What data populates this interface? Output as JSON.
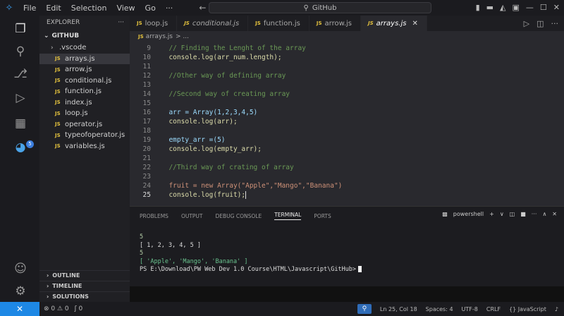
{
  "menu": {
    "items": [
      "File",
      "Edit",
      "Selection",
      "View",
      "Go",
      "···"
    ]
  },
  "nav": {
    "back": "←",
    "forward": "→"
  },
  "search": {
    "text": "GitHub"
  },
  "window": {
    "controls": [
      "▮",
      "▬",
      "◭",
      "▣",
      "—",
      "☐",
      "✕"
    ]
  },
  "activity": {
    "badge": "5"
  },
  "explorer": {
    "title": "EXPLORER",
    "more": "···",
    "folder": "GITHUB",
    "items": [
      {
        "label": ".vscode",
        "kind": "folder"
      },
      {
        "label": "arrays.js",
        "kind": "js",
        "active": true
      },
      {
        "label": "arrow.js",
        "kind": "js"
      },
      {
        "label": "conditional.js",
        "kind": "js"
      },
      {
        "label": "function.js",
        "kind": "js"
      },
      {
        "label": "index.js",
        "kind": "js"
      },
      {
        "label": "loop.js",
        "kind": "js"
      },
      {
        "label": "operator.js",
        "kind": "js"
      },
      {
        "label": "typeofoperator.js",
        "kind": "js"
      },
      {
        "label": "variables.js",
        "kind": "js"
      }
    ],
    "sections": [
      "OUTLINE",
      "TIMELINE",
      "SOLUTIONS"
    ]
  },
  "tabs": [
    {
      "label": "loop.js"
    },
    {
      "label": "conditional.js",
      "italic": true
    },
    {
      "label": "function.js"
    },
    {
      "label": "arrow.js"
    },
    {
      "label": "arrays.js",
      "active": true
    }
  ],
  "tab_close": "✕",
  "breadcrumb": {
    "file": "arrays.js",
    "sep": "> ..."
  },
  "editor": {
    "lines": [
      {
        "n": "9",
        "code": "  // Finding the Lenght of the array"
      },
      {
        "n": "10",
        "code": "  console.log(arr_num.length);"
      },
      {
        "n": "11",
        "code": ""
      },
      {
        "n": "12",
        "code": "  //Other way of defining array"
      },
      {
        "n": "13",
        "code": ""
      },
      {
        "n": "14",
        "code": "  //Second way of creating array"
      },
      {
        "n": "15",
        "code": ""
      },
      {
        "n": "16",
        "code": "  arr = Array(1,2,3,4,5)"
      },
      {
        "n": "17",
        "code": "  console.log(arr);"
      },
      {
        "n": "18",
        "code": ""
      },
      {
        "n": "19",
        "code": "  empty_arr =(5)"
      },
      {
        "n": "20",
        "code": "  console.log(empty_arr);"
      },
      {
        "n": "21",
        "code": ""
      },
      {
        "n": "22",
        "code": "  //Third way of crating of array"
      },
      {
        "n": "23",
        "code": ""
      },
      {
        "n": "24",
        "code": "  fruit = new Array(\"Apple\",\"Mango\",\"Banana\")"
      },
      {
        "n": "25",
        "code": "  console.log(fruit);"
      }
    ]
  },
  "panel": {
    "tabs": [
      "PROBLEMS",
      "OUTPUT",
      "DEBUG CONSOLE",
      "TERMINAL",
      "PORTS"
    ],
    "active_tab": "TERMINAL",
    "shell": "powershell",
    "actions": [
      "+",
      "∨",
      "◫",
      "■",
      "···",
      "∧",
      "✕"
    ],
    "terminal": [
      "5",
      "[ 1, 2, 3, 4, 5 ]",
      "5",
      "[ 'Apple', 'Mango', 'Banana' ]",
      "PS E:\\Download\\PW Web Dev 1.0 Course\\HTML\\Javascript\\GitHub>"
    ]
  },
  "status": {
    "remote": "✕",
    "problems": "⊗ 0 ⚠ 0",
    "ports": "ʃ 0",
    "position": "Ln 25, Col 18",
    "spaces": "Spaces: 4",
    "encoding": "UTF-8",
    "eol": "CRLF",
    "language": "{} JavaScript",
    "bell": "♪"
  }
}
